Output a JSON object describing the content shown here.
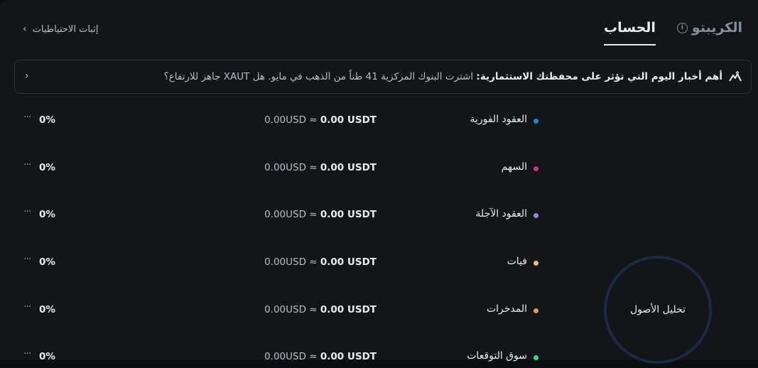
{
  "header": {
    "tabs": [
      {
        "label": "الحساب",
        "active": true
      },
      {
        "label": "الكريبتو",
        "active": false
      }
    ],
    "proof_link": "إثبات الاحتياطيات"
  },
  "news": {
    "bold": "أهم أخبار اليوم التي تؤثر على محفظتك الاستثمارية:",
    "text": "اشترت البنوك المركزية 41 طناً من الذهب في مايو. هل XAUT جاهز للارتفاع؟"
  },
  "accounts": [
    {
      "name": "العقود الفورية",
      "usdt": "0.00 USDT",
      "usd": "0.00USD ≈",
      "pct": "0%",
      "color": "#1e88e5"
    },
    {
      "name": "السهم",
      "usdt": "0.00 USDT",
      "usd": "0.00USD ≈",
      "pct": "0%",
      "color": "#d63384"
    },
    {
      "name": "العقود الآجلة",
      "usdt": "0.00 USDT",
      "usd": "0.00USD ≈",
      "pct": "0%",
      "color": "#9c7fe0"
    },
    {
      "name": "فيات",
      "usdt": "0.00 USDT",
      "usd": "0.00USD ≈",
      "pct": "0%",
      "color": "#f0c36b"
    },
    {
      "name": "المدخرات",
      "usdt": "0.00 USDT",
      "usd": "0.00USD ≈",
      "pct": "0%",
      "color": "#f0955a"
    },
    {
      "name": "سوق التوقعات",
      "usdt": "0.00 USDT",
      "usd": "0.00USD ≈",
      "pct": "0%",
      "color": "#3ddc84"
    }
  ],
  "analysis": {
    "label": "تحليل الأصول",
    "ring_color": "#1c2a45"
  },
  "colors": {
    "background": "#141519",
    "text": "#eaecef",
    "muted": "#848e9c"
  }
}
